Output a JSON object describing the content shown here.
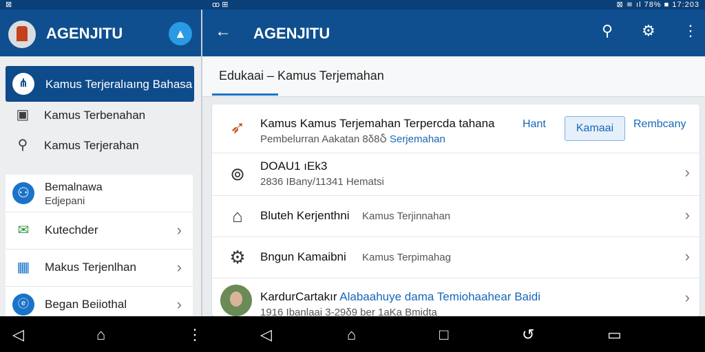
{
  "statusbar": {
    "left": "⊠",
    "mid": "ꝏ ⊞",
    "right": "⊠ ≋ ıl 78% ■ 17:203"
  },
  "drawer": {
    "title": "AGENJITU",
    "active_item": "Kamus Terjeralıaıng Bahasa",
    "items": [
      {
        "icon": "calendar-icon",
        "label": "Kamus Terbenahan"
      },
      {
        "icon": "search-icon",
        "label": "Kamus Terjerahan"
      }
    ],
    "card": {
      "profile_title": "Bemalnawa",
      "profile_sub": "Edjepani",
      "rows": [
        {
          "icon": "mail-icon",
          "label": "Kutechder"
        },
        {
          "icon": "building-icon",
          "label": "Makus Terjenlhan"
        },
        {
          "icon": "info-icon",
          "label": "Began Beiiothal"
        }
      ]
    }
  },
  "appbar": {
    "title": "AGENJITU"
  },
  "subbar": {
    "breadcrumb": "Edukaai  –  Kamus Terjemahan"
  },
  "panel": {
    "header": {
      "title": "Kamus Kamus Terjemahan Terpercda tahana",
      "sub_prefix": "Pembelurran  Aakatan 8δ8Ⴢ",
      "sub_link": "Serjemahan",
      "btn_hant": "Hant",
      "btn_kamaai": "Kamaai",
      "btn_rembcany": "Rembcany"
    },
    "rows": [
      {
        "icon": "person-circle-icon",
        "title": "DOAU1 ıEk3",
        "sub": "2836 IBany/11341 Hematsi"
      },
      {
        "icon": "home-edit-icon",
        "title": "Bluteh Kerjenthni",
        "sub": "Kamus Terjinnahan"
      },
      {
        "icon": "gear-icon",
        "title": "Bngun Kamaibni",
        "sub": "Kamus Terpimahag"
      },
      {
        "title": "KardurCartakır",
        "title_link": "Alabaahuye dama Temiohaahear Baidi",
        "sub": "1916 Ibanlaai 3-29δ9 ber 1aKa Bmidta"
      }
    ]
  },
  "navbar": {
    "left": [
      "◁",
      "⌂",
      "⋮"
    ],
    "right": [
      "◁",
      "⌂",
      "□",
      "↺",
      "▭"
    ]
  }
}
